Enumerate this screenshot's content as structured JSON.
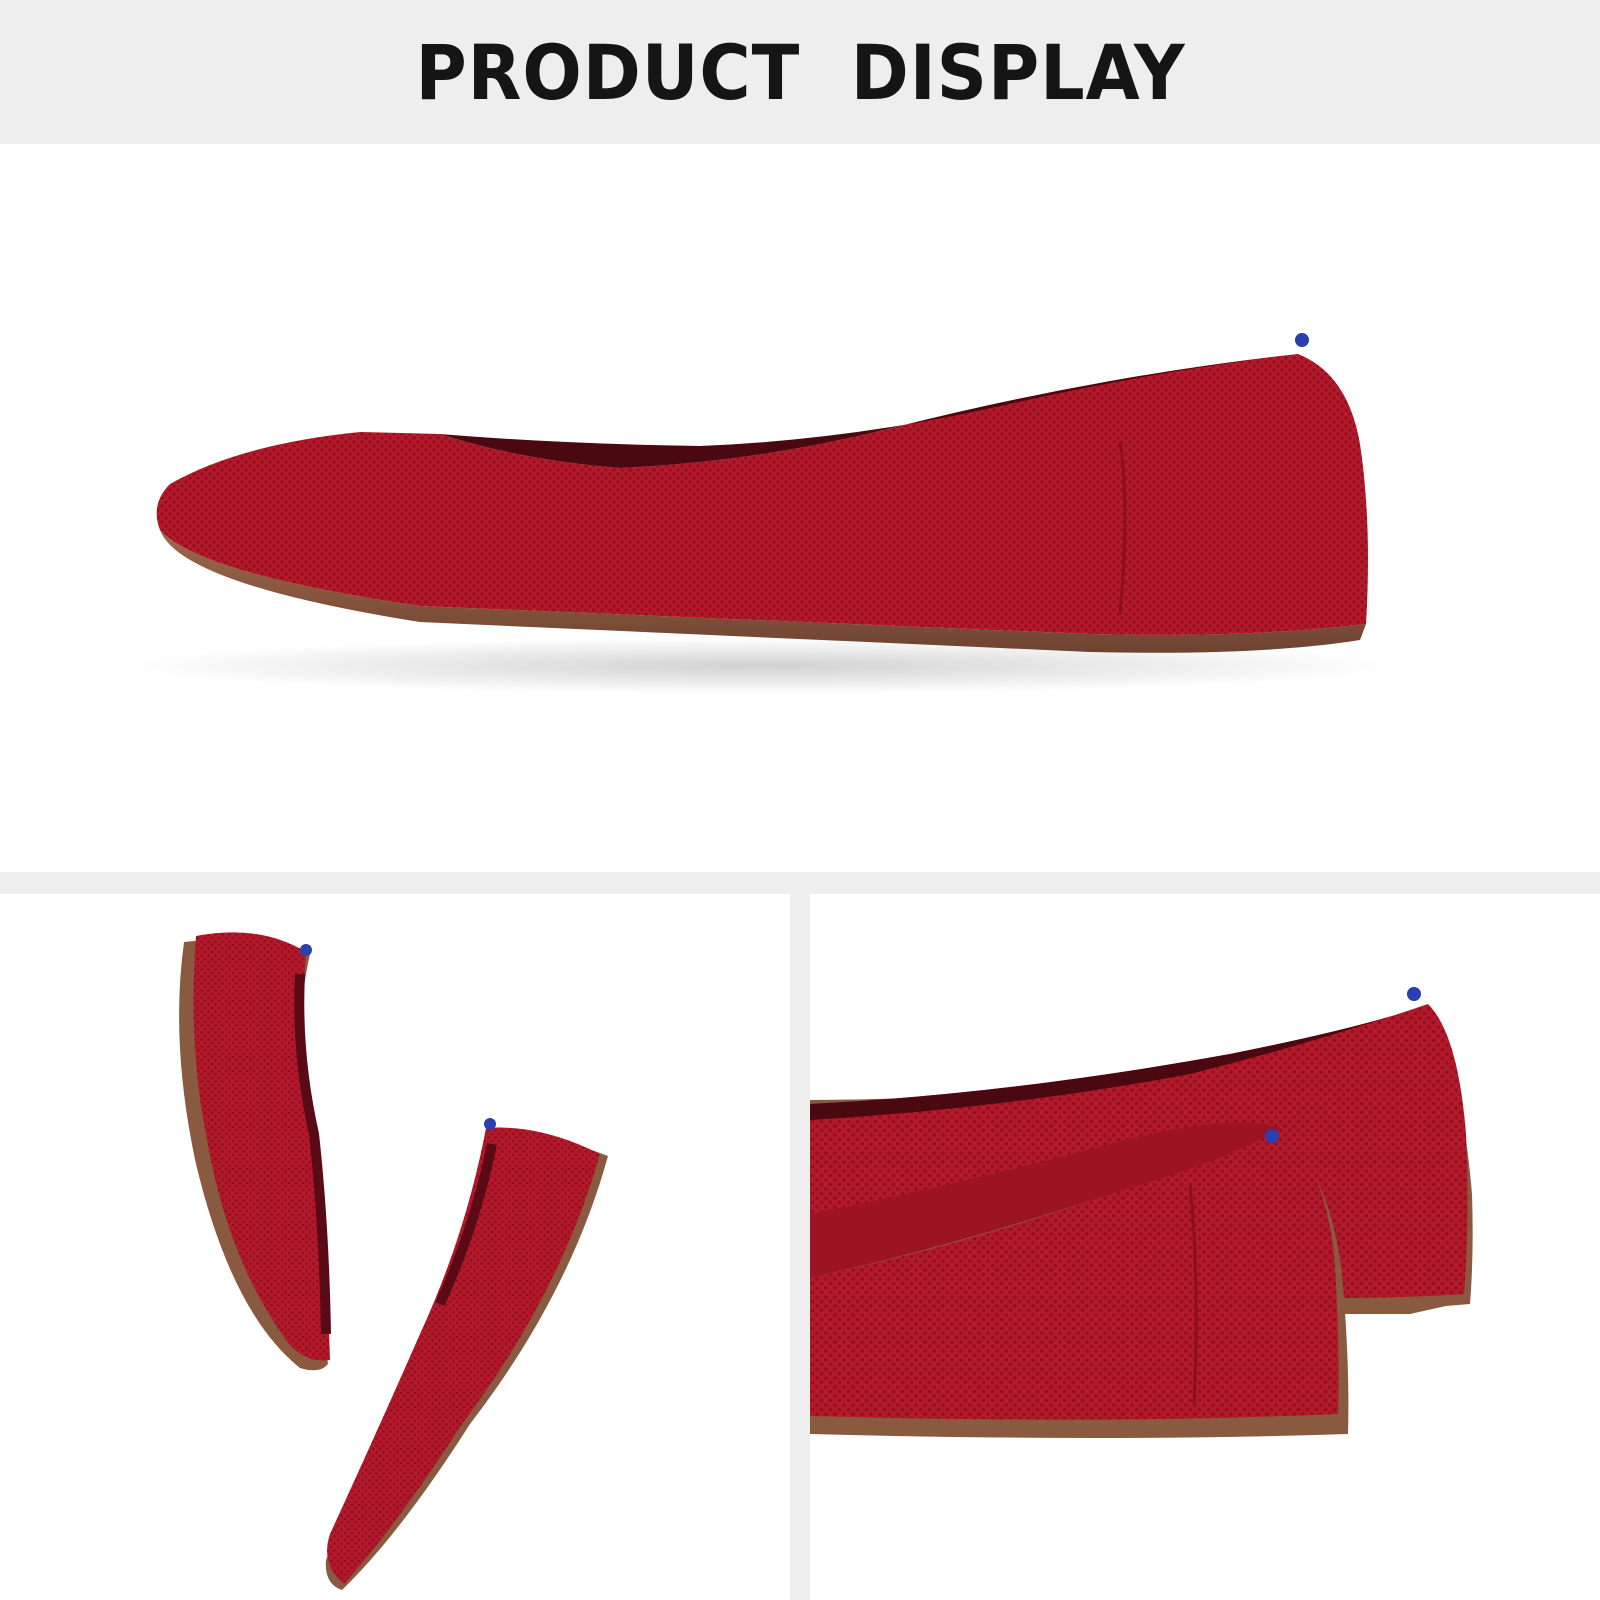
{
  "header": {
    "title": "PRODUCT  DISPLAY"
  },
  "panels": {
    "top": {
      "image": "red-knit-flat-shoe-side-view"
    },
    "bottom_left": {
      "image": "pair-of-red-flats-top-angle-view"
    },
    "bottom_right": {
      "image": "red-flats-heel-detail-view"
    }
  },
  "colors": {
    "band_background": "#efeeee",
    "title_text": "#151515",
    "knit_red": "#b01a2a",
    "sole_brown": "#8a5a40",
    "heel_tab_blue": "#2a3fb0"
  }
}
